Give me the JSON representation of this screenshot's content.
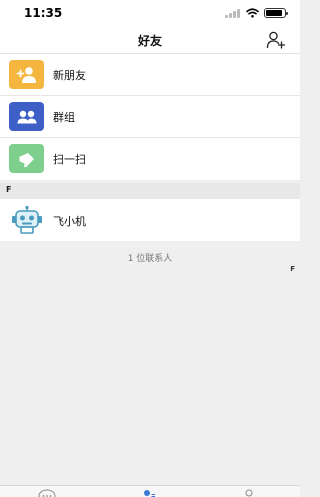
{
  "status_bar": {
    "time": "11:35"
  },
  "header": {
    "title": "好友",
    "add_icon": "add-user-icon"
  },
  "menu": [
    {
      "label": "新朋友",
      "icon": "add-friend-icon",
      "color": "#f4b63e"
    },
    {
      "label": "群组",
      "icon": "group-icon",
      "color": "#3d5fc6"
    },
    {
      "label": "扫一扫",
      "icon": "scan-icon",
      "color": "#7ecf8e"
    }
  ],
  "section": {
    "letter": "F"
  },
  "contacts": [
    {
      "name": "飞小机",
      "avatar": "robot-avatar-icon"
    }
  ],
  "contact_count": "1 位联系人",
  "index_letters": [
    "F"
  ],
  "tabs": [
    {
      "icon": "chat-icon",
      "active": false
    },
    {
      "icon": "contacts-icon",
      "active": true
    },
    {
      "icon": "me-icon",
      "active": false
    }
  ],
  "colors": {
    "accent": "#3a7bd5",
    "robot": "#4a9bbd"
  }
}
